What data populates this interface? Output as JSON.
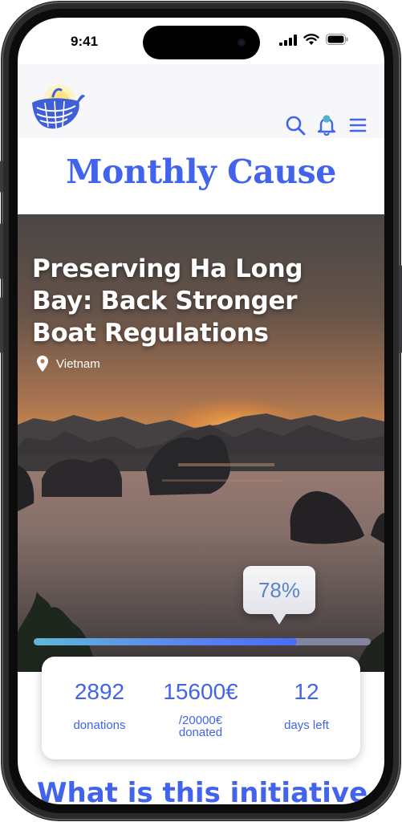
{
  "status_bar": {
    "time": "9:41"
  },
  "header": {
    "logo": "whale-logo",
    "icons": [
      "search-icon",
      "bell-icon",
      "menu-icon"
    ]
  },
  "page": {
    "title": "Monthly Cause"
  },
  "cause": {
    "title": "Preserving Ha Long Bay: Back Stronger Boat Regulations",
    "location_icon": "location-pin-icon",
    "location": "Vietnam",
    "progress_label": "78%",
    "progress_fraction": 0.78
  },
  "stats": {
    "donations": {
      "value": "2892",
      "label": "donations"
    },
    "donated": {
      "value": "15600€",
      "label_line1": "/20000€",
      "label_line2": "donated"
    },
    "days_left": {
      "value": "12",
      "label": "days left"
    }
  },
  "section": {
    "heading": "What is this initiative"
  },
  "colors": {
    "accent": "#4263eb",
    "progress_start": "#5fb8d8",
    "progress_end": "#4a6cf5"
  }
}
